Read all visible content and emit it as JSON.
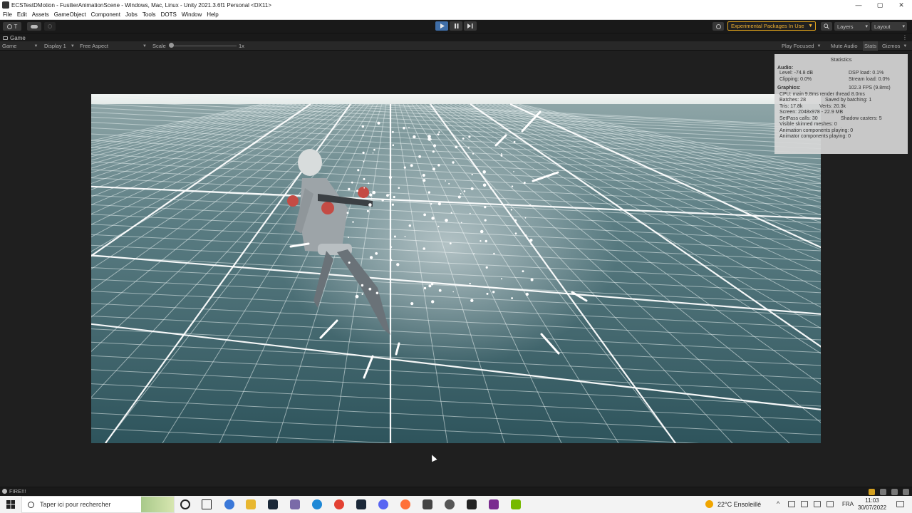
{
  "window": {
    "title": "ECSTestDMotion - FusilierAnimationScene - Windows, Mac, Linux - Unity 2021.3.6f1 Personal <DX11>",
    "minimize": "—",
    "maximize": "▢",
    "close": "✕"
  },
  "menu": [
    "File",
    "Edit",
    "Assets",
    "GameObject",
    "Component",
    "Jobs",
    "Tools",
    "DOTS",
    "Window",
    "Help"
  ],
  "toolbar": {
    "account": "T",
    "experimental": "Experimental Packages In Use",
    "layers": "Layers",
    "layout": "Layout",
    "play_icon": "play-icon",
    "pause_icon": "pause-icon",
    "step_icon": "step-icon",
    "play_color": "#3f6ea8",
    "accent_warning": "#e0a31a"
  },
  "game_tab": {
    "label": "Game"
  },
  "game_bar": {
    "mode": "Game",
    "display": "Display 1",
    "aspect": "Free Aspect",
    "scale_label": "Scale",
    "scale_value": "1x",
    "play_focused": "Play Focused",
    "mute_audio": "Mute Audio",
    "stats": "Stats",
    "gizmos": "Gizmos"
  },
  "statistics": {
    "title": "Statistics",
    "audio_header": "Audio:",
    "level": "Level: -74.8 dB",
    "dsp_load": "DSP load: 0.1%",
    "clipping": "Clipping: 0.0%",
    "stream_load": "Stream load: 0.0%",
    "graphics_header": "Graphics:",
    "fps": "102.3 FPS (9.8ms)",
    "cpu": "CPU: main 9.8ms  render thread 8.0ms",
    "batches": "Batches: 28",
    "saved_batching": "Saved by batching: 1",
    "tris": "Tris: 17.8k",
    "verts": "Verts: 20.3k",
    "screen": "Screen: 2048x978 - 22.9 MB",
    "setpass": "SetPass calls: 30",
    "shadow_casters": "Shadow casters: 5",
    "skinned_meshes": "Visible skinned meshes: 0",
    "animation_components": "Animation components playing: 0",
    "animator_components": "Animator components playing: 0"
  },
  "status": {
    "message": "FIRE!!!"
  },
  "taskbar": {
    "search_placeholder": "Taper ici pour rechercher",
    "weather": "22°C  Ensoleillé",
    "language": "FRA",
    "time": "11:03",
    "date": "30/07/2022"
  }
}
